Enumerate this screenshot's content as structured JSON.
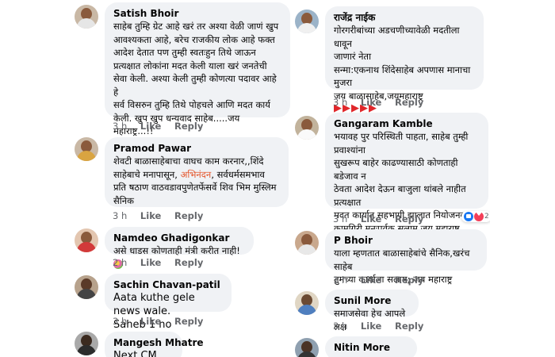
{
  "left_comments": [
    {
      "author": "Satish Bhoir",
      "text": "साहेब तुम्हि ग्रेट आहे खरं तर अश्या वेळी जाणं खुप\nआवश्यकता आहे, बरेच राजकीय लोक आहे फक्त\nआदेश देतात पण तुम्ही स्वतःहुन तिथे जाऊन\nप्रत्यक्षात लोकांना मदत केली याला खरं जनतेची\nसेवा केली. अश्या केली तुम्ही कोणत्या पदावर आहे हे\nसर्व विसरुन तुम्हि तिथे पोहचले आणि मदत कार्य\nकेली. खुप खुप धन्यवाद साहेब.....जय महाराष्ट्र...!!",
      "time": "3 h",
      "like": "Like",
      "reply": "Reply"
    },
    {
      "author": "Pramod Pawar",
      "text_part1": "शेवटी बाळासाहेबाचा वाघच काम करनार,,शिंदे\nसाहेबाचे मनापासून, ",
      "highlight": "अभिनंदन",
      "text_part2": ", सर्वधर्मसमभाव\nप्रति षठाण वाठवडावपुणेतर्फेसर्वे शिव भिम मुस्लिम\nसैनिक",
      "time": "3 h",
      "like": "Like",
      "reply": "Reply"
    },
    {
      "author": "Namdeo Ghadigonkar",
      "text": "असे धाडस कोणताही मंत्री करीत नाही!",
      "time": "2 h",
      "like": "Like",
      "reply": "Reply"
    },
    {
      "author": "Sachin Chavan-patil",
      "text": "Aata kuthe gele news wale.\nSaheb 1 no",
      "time": "3 h",
      "like": "Like",
      "reply": "Reply"
    },
    {
      "author": "Mangesh Mhatre",
      "text": "Next CM"
    }
  ],
  "right_comments": [
    {
      "author": "राजेंद्र नाईक",
      "text": "गोरगरीबांच्या अडचणीच्यावेळी मदतीला धावून\nजाणारं नेता\n सन्मा:एकनाथ शिंदेसाहेब अपणास मानाचा मुजरा\nजय बाळासाहेब,जयमहाराष्ट्र",
      "flags": "▶▶▶▶▶",
      "time": "3 h",
      "like": "Like",
      "reply": "Reply"
    },
    {
      "author": "Gangaram Kamble",
      "text": "भयावह पुर परिस्थिती पाहता, साहेब तुम्ही प्रवाश्यांना\nसुखरूप बाहेर काढण्यासाठी कोणताही बडेजाव न\nठेवता आदेश देऊन बाजुला थांबले नाहीत प्रत्यक्षात\nमदत कार्यात सहभागी झालात नियोजनबद्ध\nकामगिरी मनःपुर्वक सलाम.जय महाराष्ट्र\nऑपरेशन महालक्ष्मी एक्सप्रेस....",
      "reaction_count": "2",
      "time": "3 h",
      "like": "Like",
      "reply": "Reply"
    },
    {
      "author": "P Bhoir",
      "text": "याला म्हणतात बाळासाहेबांचे सैनिक,खरंच साहेब\nतुमच्या कार्याला सलाम; जय महाराष्ट्र",
      "time": "1 h",
      "like": "Like",
      "reply": "Reply"
    },
    {
      "author": "Sunil More",
      "text": "समाजसेवा हेच आपले लक्ष",
      "time": "3 h",
      "like": "Like",
      "reply": "Reply"
    },
    {
      "author": "Nitin More",
      "text": ""
    }
  ]
}
